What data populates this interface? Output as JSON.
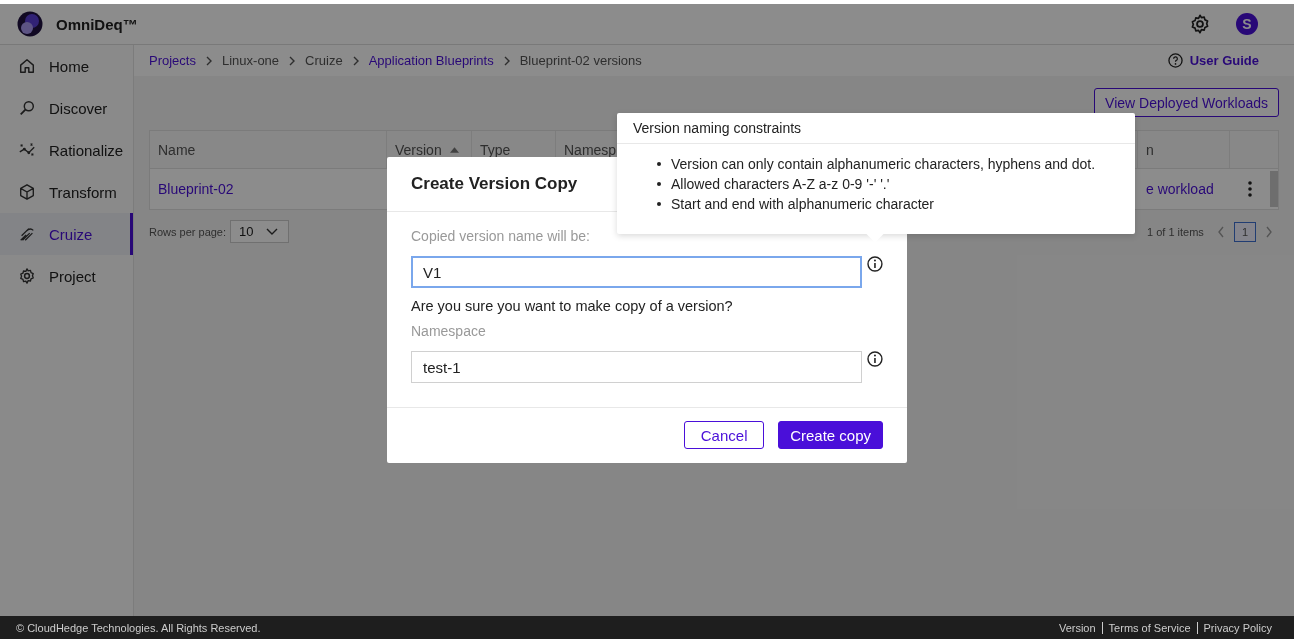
{
  "app": {
    "name": "OmniDeq™"
  },
  "header": {
    "avatar": "S"
  },
  "sidebar": {
    "items": [
      {
        "label": "Home",
        "selected": false
      },
      {
        "label": "Discover",
        "selected": false
      },
      {
        "label": "Rationalize",
        "selected": false
      },
      {
        "label": "Transform",
        "selected": false
      },
      {
        "label": "Cruize",
        "selected": true
      },
      {
        "label": "Project",
        "selected": false
      }
    ]
  },
  "breadcrumb": [
    {
      "label": "Projects",
      "link": true
    },
    {
      "label": "Linux-one",
      "link": false
    },
    {
      "label": "Cruize",
      "link": false
    },
    {
      "label": "Application Blueprints",
      "link": true
    },
    {
      "label": "Blueprint-02 versions",
      "link": false
    }
  ],
  "user_guide": "User Guide",
  "view_button": "View Deployed Workloads",
  "table": {
    "columns": [
      {
        "label": "Name",
        "sorted": false
      },
      {
        "label": "Version",
        "sorted": true
      },
      {
        "label": "Type",
        "sorted": false
      },
      {
        "label": "Namesp"
      },
      {
        "label": "n"
      }
    ],
    "rows": [
      {
        "name": "Blueprint-02",
        "column_5": "e workload"
      }
    ]
  },
  "pagination": {
    "rows_per_page_label": "Rows per page:",
    "rows_per_page": "10",
    "range": "1 of 1 items",
    "pages": [
      {
        "label": "1",
        "selected": true
      }
    ]
  },
  "dialog": {
    "title": "Create Version Copy",
    "copy_field": {
      "label": "Copied version name will be:",
      "value": "V1",
      "focused": true
    },
    "question": "Are you sure you want to make copy of a version?",
    "namespace_field": {
      "label": "Namespace",
      "value": "test-1",
      "focused": false
    },
    "buttons": [
      {
        "label": "Cancel",
        "kind": "secondary"
      },
      {
        "label": "Create copy",
        "kind": "primary"
      }
    ]
  },
  "tooltip": {
    "title": "Version naming constraints",
    "bullets": [
      "Version can only contain alphanumeric characters, hyphens and dot.",
      "Allowed characters A-Z a-z 0-9 '-' '.'",
      "Start and end with alphanumeric character"
    ]
  },
  "footer": {
    "copyright": "© CloudHedge Technologies. All Rights Reserved.",
    "links": [
      "Version",
      "Terms of Service",
      "Privacy Policy"
    ]
  }
}
